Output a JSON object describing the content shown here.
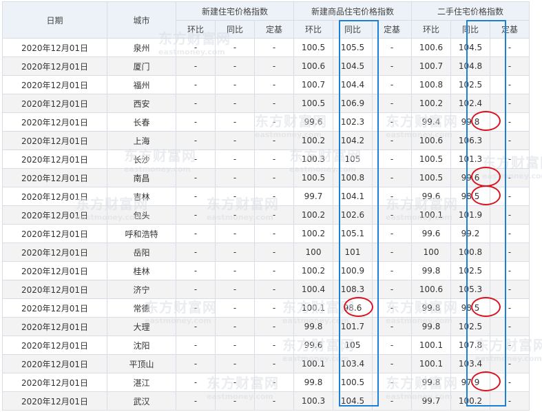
{
  "header": {
    "date": "日期",
    "city": "城市",
    "groups": [
      "新建住宅价格指数",
      "新建商品住宅价格指数",
      "二手住宅价格指数"
    ],
    "subs": [
      "环比",
      "同比",
      "定基"
    ]
  },
  "watermark": {
    "cn": "东方财富网",
    "en": "eastmoney.com"
  },
  "rows": [
    {
      "date": "2020年12月01日",
      "city": "泉州",
      "a": [
        "-",
        "-",
        "-"
      ],
      "b": [
        "100.5",
        "105.5",
        "-"
      ],
      "c": [
        "100.6",
        "104.5",
        "-"
      ]
    },
    {
      "date": "2020年12月01日",
      "city": "厦门",
      "a": [
        "-",
        "-",
        "-"
      ],
      "b": [
        "100.6",
        "104.5",
        "-"
      ],
      "c": [
        "100.7",
        "104.8",
        "-"
      ]
    },
    {
      "date": "2020年12月01日",
      "city": "福州",
      "a": [
        "-",
        "-",
        "-"
      ],
      "b": [
        "100.7",
        "104.4",
        "-"
      ],
      "c": [
        "100.8",
        "102.5",
        "-"
      ]
    },
    {
      "date": "2020年12月01日",
      "city": "西安",
      "a": [
        "-",
        "-",
        "-"
      ],
      "b": [
        "100.5",
        "106.9",
        "-"
      ],
      "c": [
        "100.2",
        "102.4",
        "-"
      ]
    },
    {
      "date": "2020年12月01日",
      "city": "长春",
      "a": [
        "-",
        "-",
        "-"
      ],
      "b": [
        "99.6",
        "102.3",
        "-"
      ],
      "c": [
        "99.4",
        "99.8",
        "-"
      ]
    },
    {
      "date": "2020年12月01日",
      "city": "上海",
      "a": [
        "-",
        "-",
        "-"
      ],
      "b": [
        "100.2",
        "104.2",
        "-"
      ],
      "c": [
        "100.6",
        "106.3",
        "-"
      ]
    },
    {
      "date": "2020年12月01日",
      "city": "长沙",
      "a": [
        "-",
        "-",
        "-"
      ],
      "b": [
        "100.3",
        "105",
        "-"
      ],
      "c": [
        "100.5",
        "101.3",
        "-"
      ]
    },
    {
      "date": "2020年12月01日",
      "city": "南昌",
      "a": [
        "-",
        "-",
        "-"
      ],
      "b": [
        "100.5",
        "100.8",
        "-"
      ],
      "c": [
        "100.5",
        "99.6",
        "-"
      ]
    },
    {
      "date": "2020年12月01日",
      "city": "吉林",
      "a": [
        "-",
        "-",
        "-"
      ],
      "b": [
        "99.7",
        "104.1",
        "-"
      ],
      "c": [
        "99.6",
        "98.5",
        "-"
      ]
    },
    {
      "date": "2020年12月01日",
      "city": "包头",
      "a": [
        "-",
        "-",
        "-"
      ],
      "b": [
        "100.2",
        "102.6",
        "-"
      ],
      "c": [
        "100.1",
        "101.9",
        "-"
      ]
    },
    {
      "date": "2020年12月01日",
      "city": "呼和浩特",
      "a": [
        "-",
        "-",
        "-"
      ],
      "b": [
        "100.2",
        "105.1",
        "-"
      ],
      "c": [
        "99.6",
        "99.2",
        "-"
      ]
    },
    {
      "date": "2020年12月01日",
      "city": "岳阳",
      "a": [
        "-",
        "-",
        "-"
      ],
      "b": [
        "100",
        "101",
        "-"
      ],
      "c": [
        "100",
        "100.8",
        "-"
      ]
    },
    {
      "date": "2020年12月01日",
      "city": "桂林",
      "a": [
        "-",
        "-",
        "-"
      ],
      "b": [
        "100.2",
        "100.9",
        "-"
      ],
      "c": [
        "99.8",
        "102.5",
        "-"
      ]
    },
    {
      "date": "2020年12月01日",
      "city": "济宁",
      "a": [
        "-",
        "-",
        "-"
      ],
      "b": [
        "100.4",
        "108.3",
        "-"
      ],
      "c": [
        "100.6",
        "105.3",
        "-"
      ]
    },
    {
      "date": "2020年12月01日",
      "city": "常德",
      "a": [
        "-",
        "-",
        "-"
      ],
      "b": [
        "100.1",
        "98.6",
        "-"
      ],
      "c": [
        "99.8",
        "98.5",
        "-"
      ]
    },
    {
      "date": "2020年12月01日",
      "city": "大理",
      "a": [
        "-",
        "-",
        "-"
      ],
      "b": [
        "99.8",
        "101.7",
        "-"
      ],
      "c": [
        "99.8",
        "102.5",
        "-"
      ]
    },
    {
      "date": "2020年12月01日",
      "city": "沈阳",
      "a": [
        "-",
        "-",
        "-"
      ],
      "b": [
        "99.6",
        "105",
        "-"
      ],
      "c": [
        "100.1",
        "107.8",
        "-"
      ]
    },
    {
      "date": "2020年12月01日",
      "city": "平顶山",
      "a": [
        "-",
        "-",
        "-"
      ],
      "b": [
        "100.1",
        "103.4",
        "-"
      ],
      "c": [
        "100.1",
        "103.4",
        "-"
      ]
    },
    {
      "date": "2020年12月01日",
      "city": "湛江",
      "a": [
        "-",
        "-",
        "-"
      ],
      "b": [
        "99.8",
        "100.5",
        "-"
      ],
      "c": [
        "99.8",
        "97.9",
        "-"
      ]
    },
    {
      "date": "2020年12月01日",
      "city": "武汉",
      "a": [
        "-",
        "-",
        "-"
      ],
      "b": [
        "100.3",
        "104.5",
        "-"
      ],
      "c": [
        "99.7",
        "100.2",
        "-"
      ]
    }
  ],
  "highlight": {
    "box_color": "#1a7fd6",
    "circle_color": "#d9141f",
    "boxed_columns": [
      "新建商品住宅价格指数.同比",
      "二手住宅价格指数.同比"
    ],
    "circled_cells": [
      {
        "city": "长春",
        "group": "二手住宅价格指数",
        "sub": "同比",
        "value": "99.8"
      },
      {
        "city": "南昌",
        "group": "二手住宅价格指数",
        "sub": "同比",
        "value": "99.6"
      },
      {
        "city": "吉林",
        "group": "二手住宅价格指数",
        "sub": "同比",
        "value": "98.5"
      },
      {
        "city": "常德",
        "group": "新建商品住宅价格指数",
        "sub": "同比",
        "value": "98.6"
      },
      {
        "city": "常德",
        "group": "二手住宅价格指数",
        "sub": "同比",
        "value": "98.5"
      },
      {
        "city": "湛江",
        "group": "二手住宅价格指数",
        "sub": "同比",
        "value": "97.9"
      }
    ]
  }
}
